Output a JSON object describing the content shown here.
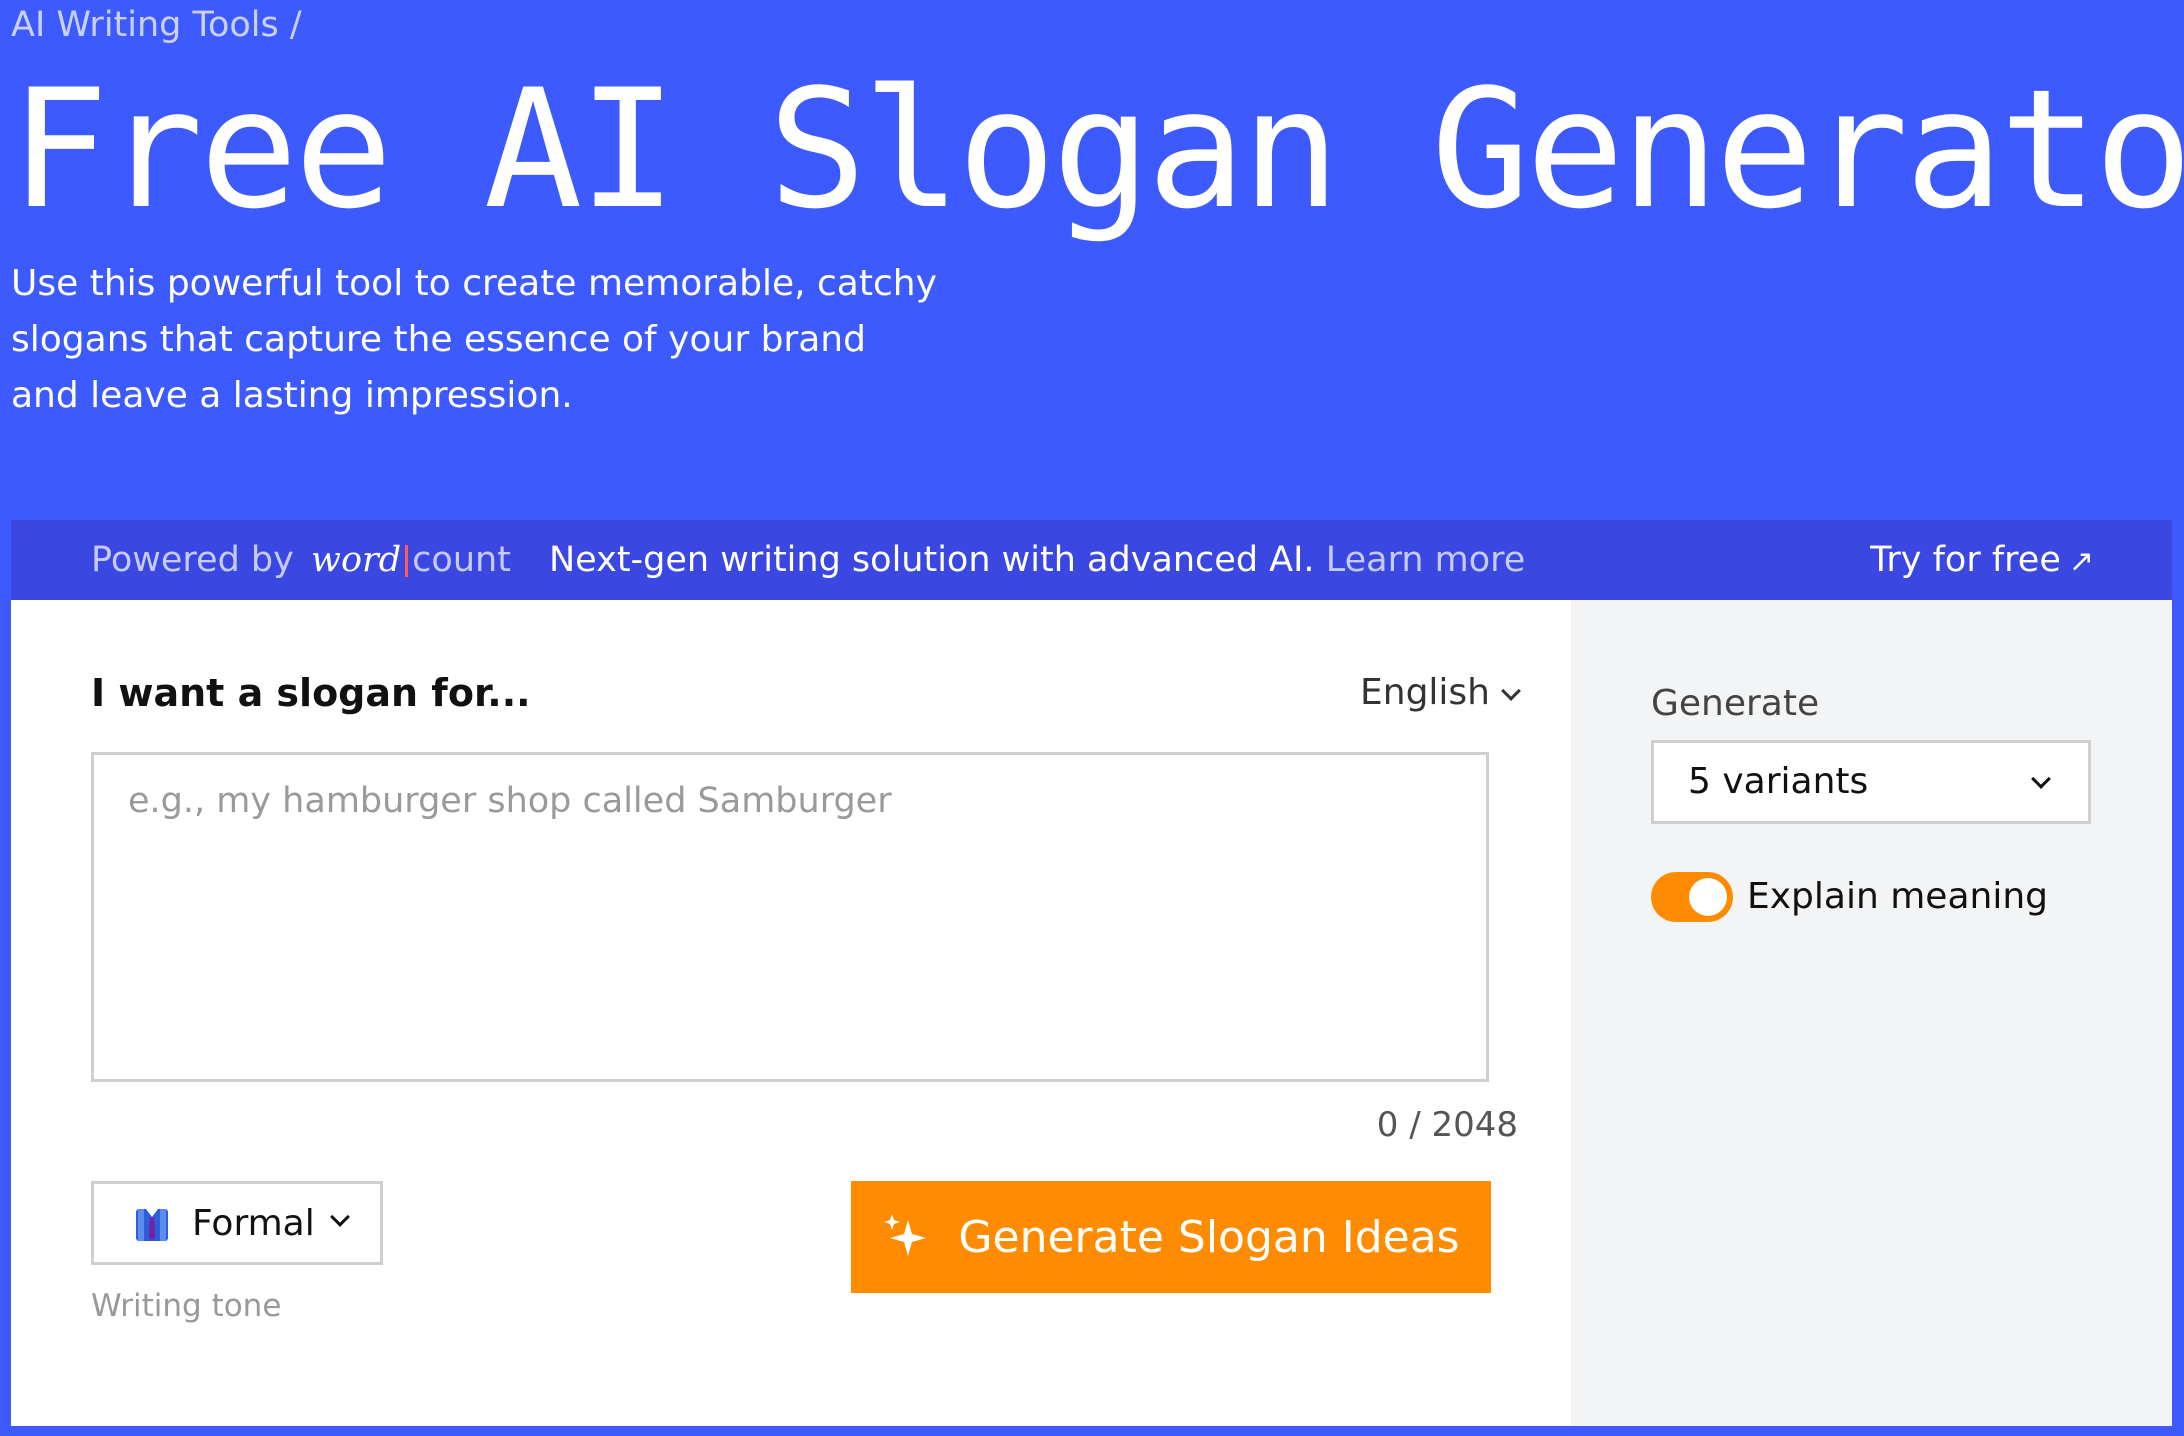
{
  "breadcrumb": "AI Writing Tools /",
  "hero": {
    "title": "Free AI Slogan Generator",
    "subtitle": "Use this powerful tool to create memorable, catchy slogans that capture the essence of your brand and leave a lasting impression."
  },
  "promo": {
    "powered_by": "Powered by",
    "brand_word": "word",
    "brand_count": "count",
    "message": "Next-gen writing solution with advanced AI.",
    "learn_more": "Learn more",
    "try_free": "Try for free"
  },
  "form": {
    "slogan_label": "I want a slogan for...",
    "language": "English",
    "placeholder": "e.g., my hamburger shop called Samburger",
    "value": "",
    "char_count": "0 / 2048",
    "tone": "Formal",
    "tone_caption": "Writing tone",
    "generate_button": "Generate Slogan Ideas"
  },
  "options": {
    "generate_label": "Generate",
    "variants": "5 variants",
    "explain_meaning": "Explain meaning",
    "explain_enabled": true
  },
  "colors": {
    "brand_blue": "#3d5afe",
    "promo_bar": "#3a47e0",
    "accent_orange": "#ff8c00",
    "side_panel": "#f3f4f5"
  },
  "icons": {
    "tone": "suit-icon",
    "generate": "sparkle-icon",
    "try_free": "arrow-up-right-icon",
    "dropdown": "chevron-down-icon"
  }
}
